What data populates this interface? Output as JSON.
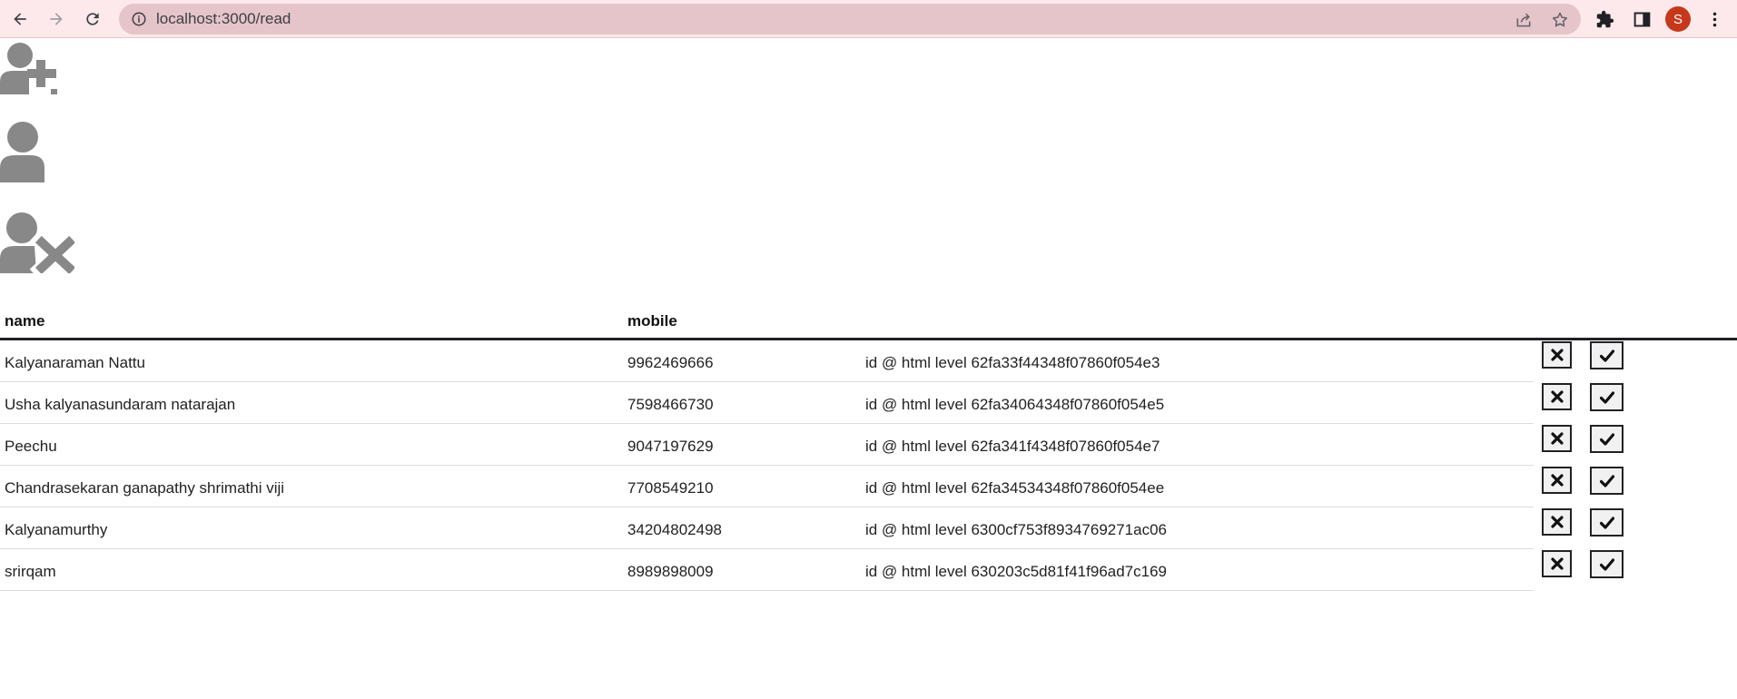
{
  "browser": {
    "url": "localhost:3000/read",
    "profile_initial": "S",
    "profile_color": "#c5381c",
    "icons": [
      "back-arrow-icon",
      "forward-arrow-icon",
      "reload-icon",
      "site-info-icon",
      "share-icon",
      "bookmark-star-icon",
      "extensions-puzzle-icon",
      "side-panel-icon",
      "more-menu-icon"
    ]
  },
  "page": {
    "actions": [
      {
        "name": "add-user",
        "icon": "user-plus-icon"
      },
      {
        "name": "view-user",
        "icon": "user-icon"
      },
      {
        "name": "delete-user",
        "icon": "user-remove-icon"
      }
    ],
    "icon_color": "#888888"
  },
  "table": {
    "headers": {
      "name": "name",
      "mobile": "mobile"
    },
    "rows": [
      {
        "name": "Kalyanaraman Nattu",
        "mobile": "9962469666",
        "id_text": "id @ html level 62fa33f44348f07860f054e3"
      },
      {
        "name": "Usha kalyanasundaram natarajan",
        "mobile": "7598466730",
        "id_text": "id @ html level 62fa34064348f07860f054e5"
      },
      {
        "name": "Peechu",
        "mobile": "9047197629",
        "id_text": "id @ html level 62fa341f4348f07860f054e7"
      },
      {
        "name": "Chandrasekaran ganapathy shrimathi viji",
        "mobile": "7708549210",
        "id_text": "id @ html level 62fa34534348f07860f054ee"
      },
      {
        "name": "Kalyanamurthy",
        "mobile": "34204802498",
        "id_text": "id @ html level 6300cf753f8934769271ac06"
      },
      {
        "name": "srirqam",
        "mobile": "8989898009",
        "id_text": "id @ html level 630203c5d81f41f96ad7c169"
      }
    ],
    "row_actions": {
      "delete_icon": "times-icon",
      "confirm_icon": "check-icon"
    }
  }
}
